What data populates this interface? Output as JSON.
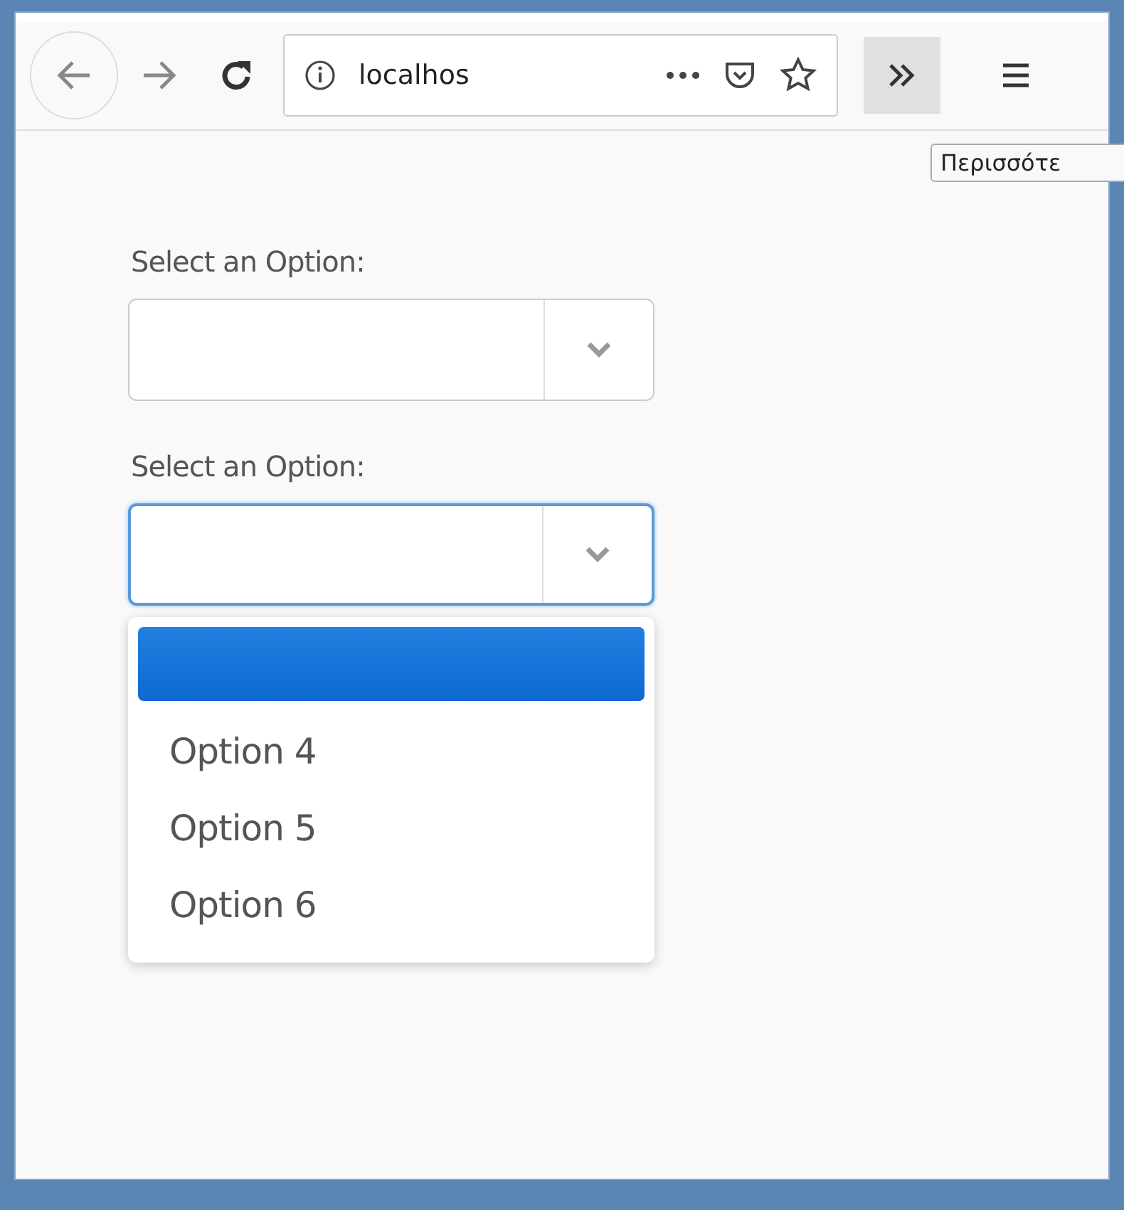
{
  "toolbar": {
    "address": "localhos",
    "tooltip": "Περισσότε"
  },
  "selects": [
    {
      "label": "Select an Option:",
      "focused": false
    },
    {
      "label": "Select an Option:",
      "focused": true,
      "options": [
        {
          "selected": true
        },
        {
          "label": "Option 4",
          "selected": false
        },
        {
          "label": "Option 5",
          "selected": false
        },
        {
          "label": "Option 6",
          "selected": false
        }
      ]
    }
  ]
}
